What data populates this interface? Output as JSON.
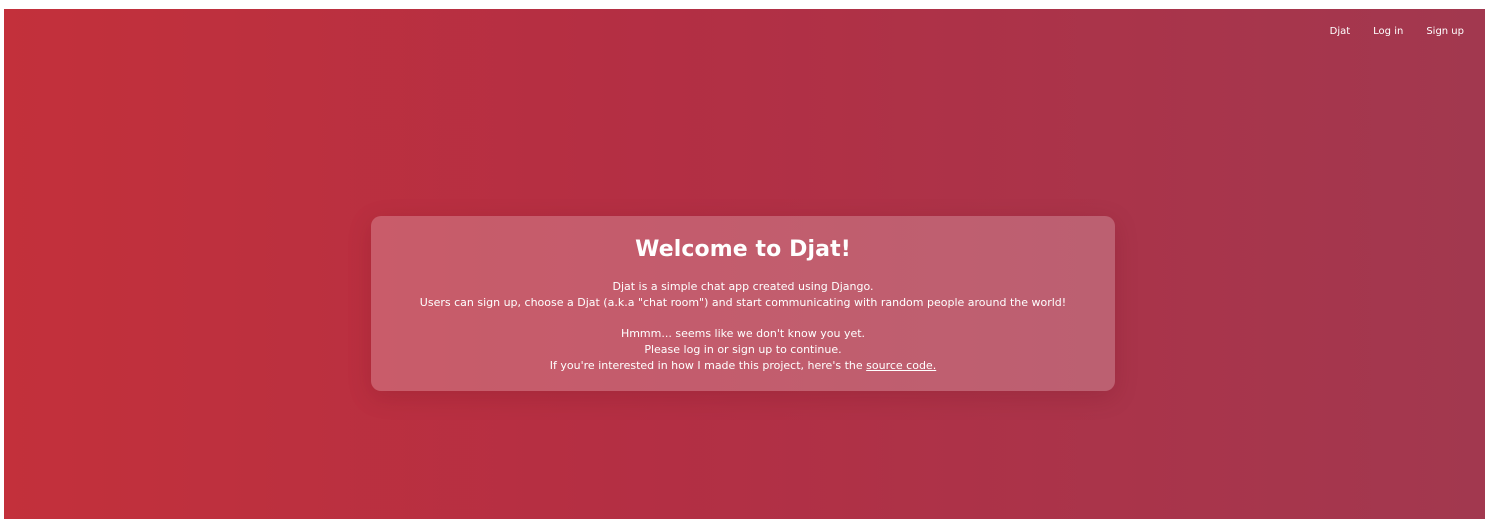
{
  "nav": {
    "items": [
      {
        "label": "Djat"
      },
      {
        "label": "Log in"
      },
      {
        "label": "Sign up"
      }
    ]
  },
  "welcome": {
    "title": "Welcome to Djat!",
    "intro_line1": "Djat is a simple chat app created using Django.",
    "intro_line2": "Users can sign up, choose a Djat (a.k.a \"chat room\") and start communicating with random people around the world!",
    "unknown_line": "Hmmm... seems like we don't know you yet.",
    "prompt_line": "Please log in or sign up to continue.",
    "source_prefix": "If you're interested in how I made this project, here's the ",
    "source_link": "source code."
  },
  "colors": {
    "gradient_start": "#c3303b",
    "gradient_end": "#a2384f",
    "text": "#ffffff"
  }
}
